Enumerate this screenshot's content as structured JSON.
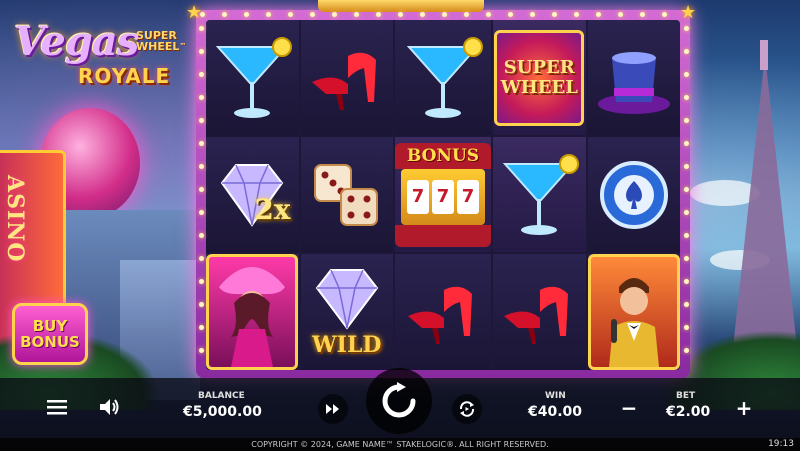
{
  "logo": {
    "line1": "Vegas",
    "line2a": "SUPER",
    "line2b": "WHEEL",
    "tm": "™",
    "line3": "ROYALE"
  },
  "background": {
    "casino_sign": "ASINO"
  },
  "reels": [
    [
      "cocktail",
      "diamond-2x",
      "showgirl"
    ],
    [
      "red-heels",
      "dice",
      "diamond-wild"
    ],
    [
      "cocktail",
      "bonus-slot",
      "red-heels"
    ],
    [
      "super-wheel",
      "cocktail",
      "red-heels"
    ],
    [
      "top-hat",
      "poker-chip",
      "crooner"
    ]
  ],
  "symbols": {
    "multiplier_label": "2x",
    "wild_label": "WILD",
    "bonus_label": "BONUS",
    "bonus_reels": [
      "7",
      "7",
      "7"
    ],
    "super_wheel_line1": "SUPER",
    "super_wheel_line2": "WHEEL"
  },
  "buy_bonus": {
    "line1": "BUY",
    "line2": "BONUS"
  },
  "hud": {
    "balance_label": "BALANCE",
    "balance_value": "€5,000.00",
    "win_label": "WIN",
    "win_value": "€40.00",
    "bet_label": "BET",
    "bet_value": "€2.00",
    "minus": "−",
    "plus": "+"
  },
  "footer": {
    "copyright": "COPYRIGHT © 2024, GAME NAME™ STAKELOGIC®. ALL RIGHT RESERVED.",
    "clock": "19:13"
  },
  "colors": {
    "accent_gold": "#ffd34d",
    "frame_purple": "#8a2aa0",
    "buy_pink": "#ff5fd0"
  }
}
